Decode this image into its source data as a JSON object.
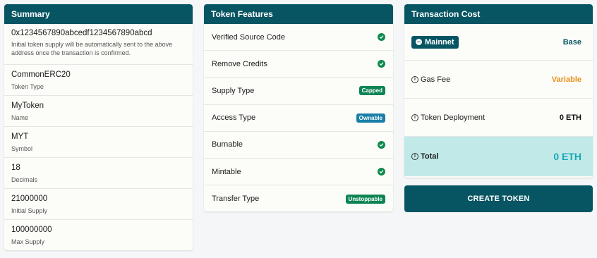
{
  "summary": {
    "title": "Summary",
    "address": "0x1234567890abcedf1234567890abcd",
    "address_note": "Initial token supply will be automatically sent to the above address once the transaction is confirmed.",
    "rows": [
      {
        "value": "CommonERC20",
        "label": "Token Type"
      },
      {
        "value": "MyToken",
        "label": "Name"
      },
      {
        "value": "MYT",
        "label": "Symbol"
      },
      {
        "value": "18",
        "label": "Decimals"
      },
      {
        "value": "21000000",
        "label": "Initial Supply"
      },
      {
        "value": "100000000",
        "label": "Max Supply"
      }
    ]
  },
  "features": {
    "title": "Token Features",
    "rows": [
      {
        "label": "Verified Source Code",
        "status": "check"
      },
      {
        "label": "Remove Credits",
        "status": "check"
      },
      {
        "label": "Supply Type",
        "badge": "Capped",
        "badge_color": "#0d8453"
      },
      {
        "label": "Access Type",
        "badge": "Ownable",
        "badge_color": "#1a7fa8"
      },
      {
        "label": "Burnable",
        "status": "check"
      },
      {
        "label": "Mintable",
        "status": "check"
      },
      {
        "label": "Transfer Type",
        "badge": "Unstoppable",
        "badge_color": "#0d8453"
      }
    ]
  },
  "cost": {
    "title": "Transaction Cost",
    "network_label": "Mainnet",
    "network_value": "Base",
    "gas_fee_label": "Gas Fee",
    "gas_fee_value": "Variable",
    "deployment_label": "Token Deployment",
    "deployment_value": "0 ETH",
    "total_label": "Total",
    "total_value": "0 ETH"
  },
  "create_button": "CREATE TOKEN",
  "colors": {
    "primary": "#075563",
    "success": "#0f8a4f",
    "accent_orange": "#e8901a",
    "total_bg": "#c1e9e8",
    "total_text": "#17a8b3"
  }
}
